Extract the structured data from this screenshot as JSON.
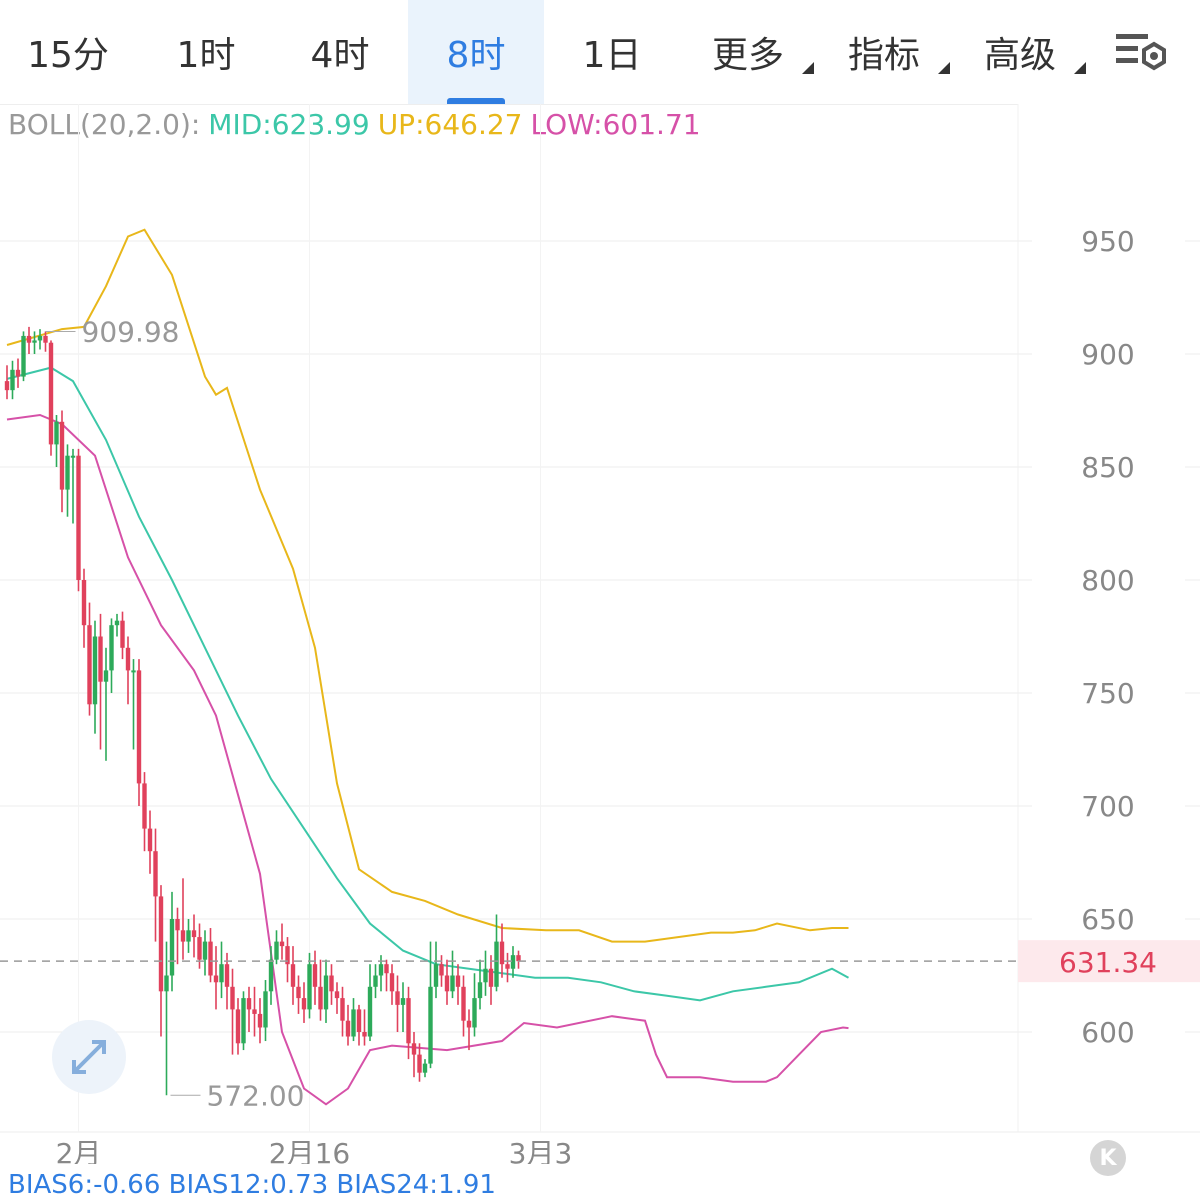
{
  "tabs": [
    {
      "label": "15分",
      "active": false,
      "dropdown": false
    },
    {
      "label": "1时",
      "active": false,
      "dropdown": false
    },
    {
      "label": "4时",
      "active": false,
      "dropdown": false
    },
    {
      "label": "8时",
      "active": true,
      "dropdown": false
    },
    {
      "label": "1日",
      "active": false,
      "dropdown": false
    },
    {
      "label": "更多",
      "active": false,
      "dropdown": true
    },
    {
      "label": "指标",
      "active": false,
      "dropdown": true
    },
    {
      "label": "高级",
      "active": false,
      "dropdown": true
    }
  ],
  "settings_icon": "chart-settings-icon",
  "boll": {
    "name": "BOLL(20,2.0):",
    "mid": "MID:623.99",
    "up": "UP:646.27",
    "low": "LOW:601.71"
  },
  "colors": {
    "up_candle": "#2daa5a",
    "down_candle": "#e0415c",
    "mid": "#3cc7a8",
    "upper": "#e8b71a",
    "lower": "#d651a8",
    "active_tab": "#2f7de1",
    "price_tag": "#e0415c"
  },
  "last_price": "631.34",
  "k_badge": "K",
  "bias_text": "BIAS6:-0.66 BIAS12:0.73 BIAS24:1.91",
  "chart_data": {
    "type": "candlestick",
    "ylim": [
      545,
      1000
    ],
    "y_ticks": [
      600,
      650,
      700,
      750,
      800,
      850,
      900,
      950
    ],
    "x_ticks": [
      {
        "label": "2月",
        "bar": 13
      },
      {
        "label": "2月16",
        "bar": 55
      },
      {
        "label": "3月3",
        "bar": 97
      }
    ],
    "last_price": 631.34,
    "max_annotation": {
      "label": "909.98",
      "value": 909.98,
      "bar": 7
    },
    "min_annotation": {
      "label": "572.00",
      "value": 572.0,
      "bar": 29
    },
    "series_keys": [
      "close",
      "mid",
      "upper",
      "lower"
    ],
    "candles": [
      [
        888,
        884,
        895,
        880
      ],
      [
        884,
        893,
        897,
        880
      ],
      [
        893,
        890,
        898,
        885
      ],
      [
        890,
        908,
        910,
        888
      ],
      [
        908,
        905,
        912,
        900
      ],
      [
        905,
        906,
        910,
        900
      ],
      [
        906,
        908,
        911,
        902
      ],
      [
        908,
        905,
        909.98,
        901
      ],
      [
        905,
        860,
        906,
        855
      ],
      [
        860,
        870,
        873,
        850
      ],
      [
        870,
        840,
        875,
        830
      ],
      [
        840,
        855,
        860,
        828
      ],
      [
        855,
        855,
        858,
        825
      ],
      [
        855,
        800,
        858,
        795
      ],
      [
        800,
        780,
        805,
        770
      ],
      [
        780,
        745,
        790,
        740
      ],
      [
        745,
        775,
        782,
        732
      ],
      [
        775,
        755,
        785,
        725
      ],
      [
        755,
        760,
        770,
        720
      ],
      [
        760,
        780,
        783,
        750
      ],
      [
        780,
        782,
        785,
        775
      ],
      [
        782,
        770,
        786,
        765
      ],
      [
        770,
        760,
        775,
        745
      ],
      [
        760,
        760,
        765,
        725
      ],
      [
        760,
        710,
        765,
        700
      ],
      [
        710,
        690,
        715,
        680
      ],
      [
        690,
        680,
        698,
        670
      ],
      [
        680,
        660,
        690,
        640
      ],
      [
        660,
        618,
        665,
        598
      ],
      [
        618,
        625,
        640,
        572
      ],
      [
        625,
        650,
        662,
        618
      ],
      [
        650,
        645,
        655,
        630
      ],
      [
        645,
        640,
        668,
        632
      ],
      [
        640,
        645,
        650,
        635
      ],
      [
        645,
        642,
        652,
        633
      ],
      [
        642,
        632,
        648,
        628
      ],
      [
        632,
        640,
        645,
        625
      ],
      [
        640,
        625,
        646,
        622
      ],
      [
        625,
        622,
        638,
        610
      ],
      [
        622,
        630,
        640,
        615
      ],
      [
        630,
        620,
        635,
        610
      ],
      [
        620,
        610,
        628,
        590
      ],
      [
        610,
        595,
        615,
        590
      ],
      [
        595,
        615,
        618,
        592
      ],
      [
        615,
        610,
        620,
        600
      ],
      [
        610,
        608,
        620,
        598
      ],
      [
        608,
        602,
        615,
        595
      ],
      [
        602,
        618,
        623,
        596
      ],
      [
        618,
        632,
        638,
        612
      ],
      [
        632,
        640,
        645,
        630
      ],
      [
        640,
        638,
        648,
        632
      ],
      [
        638,
        630,
        642,
        622
      ],
      [
        630,
        620,
        638,
        612
      ],
      [
        620,
        615,
        625,
        608
      ],
      [
        615,
        610,
        622,
        604
      ],
      [
        610,
        630,
        635,
        606
      ],
      [
        630,
        620,
        636,
        612
      ],
      [
        620,
        610,
        632,
        605
      ],
      [
        610,
        625,
        632,
        604
      ],
      [
        625,
        618,
        630,
        612
      ],
      [
        618,
        615,
        622,
        608
      ],
      [
        615,
        605,
        620,
        598
      ],
      [
        605,
        598,
        612,
        594
      ],
      [
        598,
        610,
        615,
        596
      ],
      [
        610,
        600,
        612,
        594
      ],
      [
        600,
        598,
        610,
        594
      ],
      [
        598,
        620,
        630,
        596
      ],
      [
        620,
        625,
        630,
        615
      ],
      [
        625,
        630,
        634,
        618
      ],
      [
        630,
        626,
        632,
        618
      ],
      [
        626,
        618,
        630,
        612
      ],
      [
        618,
        612,
        625,
        600
      ],
      [
        612,
        615,
        622,
        600
      ],
      [
        615,
        595,
        620,
        588
      ],
      [
        595,
        590,
        600,
        580
      ],
      [
        590,
        582,
        595,
        578
      ],
      [
        582,
        586,
        588,
        580
      ],
      [
        586,
        620,
        640,
        584
      ],
      [
        620,
        630,
        640,
        615
      ],
      [
        630,
        625,
        634,
        620
      ],
      [
        625,
        618,
        632,
        612
      ],
      [
        618,
        625,
        636,
        615
      ],
      [
        625,
        620,
        630,
        612
      ],
      [
        620,
        605,
        625,
        598
      ],
      [
        605,
        602,
        610,
        592
      ],
      [
        602,
        615,
        626,
        598
      ],
      [
        615,
        622,
        632,
        610
      ],
      [
        622,
        628,
        636,
        616
      ],
      [
        628,
        620,
        634,
        612
      ],
      [
        620,
        640,
        652,
        618
      ],
      [
        640,
        630,
        648,
        624
      ],
      [
        630,
        628,
        635,
        622
      ],
      [
        628,
        634,
        638,
        624
      ],
      [
        634,
        631.34,
        636,
        628
      ]
    ],
    "mid": [
      [
        0,
        889
      ],
      [
        8,
        894
      ],
      [
        12,
        888
      ],
      [
        18,
        862
      ],
      [
        24,
        828
      ],
      [
        30,
        800
      ],
      [
        36,
        770
      ],
      [
        42,
        740
      ],
      [
        48,
        712
      ],
      [
        54,
        690
      ],
      [
        60,
        668
      ],
      [
        66,
        648
      ],
      [
        72,
        636
      ],
      [
        78,
        630
      ],
      [
        84,
        628
      ],
      [
        90,
        626
      ],
      [
        96,
        624
      ],
      [
        102,
        624
      ],
      [
        108,
        622
      ],
      [
        114,
        618
      ],
      [
        120,
        616
      ],
      [
        126,
        614
      ],
      [
        132,
        618
      ],
      [
        138,
        620
      ],
      [
        144,
        622
      ],
      [
        150,
        628
      ],
      [
        153,
        624
      ]
    ],
    "upper": [
      [
        0,
        904
      ],
      [
        10,
        911
      ],
      [
        14,
        912
      ],
      [
        18,
        930
      ],
      [
        22,
        952
      ],
      [
        25,
        955
      ],
      [
        30,
        935
      ],
      [
        36,
        890
      ],
      [
        38,
        882
      ],
      [
        40,
        885
      ],
      [
        46,
        840
      ],
      [
        52,
        805
      ],
      [
        56,
        770
      ],
      [
        60,
        710
      ],
      [
        64,
        672
      ],
      [
        70,
        662
      ],
      [
        76,
        658
      ],
      [
        82,
        652
      ],
      [
        90,
        646
      ],
      [
        98,
        645
      ],
      [
        104,
        645
      ],
      [
        110,
        640
      ],
      [
        116,
        640
      ],
      [
        122,
        642
      ],
      [
        128,
        644
      ],
      [
        132,
        644
      ],
      [
        136,
        645
      ],
      [
        140,
        648
      ],
      [
        146,
        645
      ],
      [
        150,
        646
      ],
      [
        153,
        646
      ]
    ],
    "lower": [
      [
        0,
        871
      ],
      [
        6,
        873
      ],
      [
        10,
        869
      ],
      [
        16,
        855
      ],
      [
        22,
        810
      ],
      [
        28,
        780
      ],
      [
        34,
        760
      ],
      [
        38,
        740
      ],
      [
        42,
        705
      ],
      [
        46,
        670
      ],
      [
        50,
        600
      ],
      [
        54,
        575
      ],
      [
        58,
        568
      ],
      [
        62,
        575
      ],
      [
        66,
        592
      ],
      [
        70,
        594
      ],
      [
        80,
        592
      ],
      [
        90,
        596
      ],
      [
        94,
        604
      ],
      [
        100,
        602
      ],
      [
        110,
        607
      ],
      [
        116,
        605
      ],
      [
        118,
        590
      ],
      [
        120,
        580
      ],
      [
        126,
        580
      ],
      [
        132,
        578
      ],
      [
        138,
        578
      ],
      [
        140,
        580
      ],
      [
        144,
        590
      ],
      [
        148,
        600
      ],
      [
        152,
        602
      ],
      [
        153,
        601.71
      ]
    ]
  }
}
